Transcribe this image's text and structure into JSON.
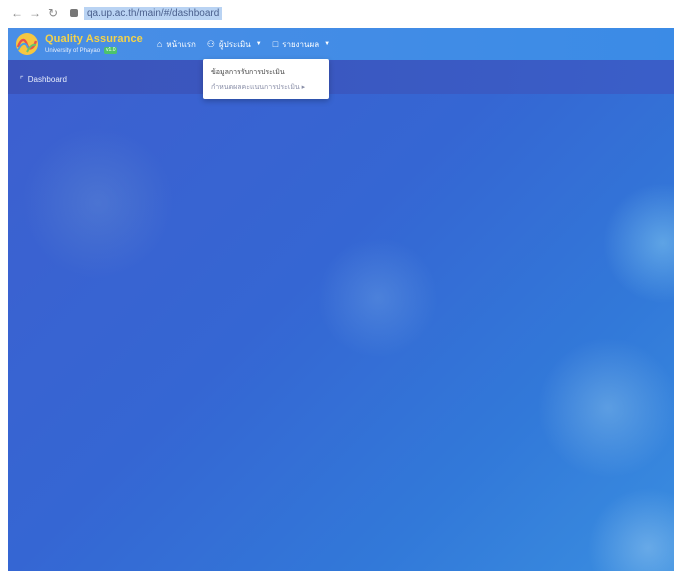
{
  "browser": {
    "back_icon": "arrow-left",
    "forward_icon": "arrow-right",
    "reload_icon": "reload",
    "url": "qa.up.ac.th/main/#/dashboard"
  },
  "navbar": {
    "brand_title": "Quality Assurance",
    "brand_subtitle": "University of Phayao",
    "brand_badge": "v1.0",
    "menu": [
      {
        "label": "หน้าแรก",
        "icon": "home-icon",
        "has_caret": false
      },
      {
        "label": "ผู้ประเมิน",
        "icon": "users-icon",
        "has_caret": true
      },
      {
        "label": "รายงานผล",
        "icon": "comment-icon",
        "has_caret": true
      }
    ]
  },
  "breadcrumb": {
    "label": "Dashboard",
    "icon": "chart-icon"
  },
  "dropdown": {
    "items": [
      {
        "label": "ข้อมูลการรับการประเมิน"
      },
      {
        "label": "กำหนดผลคะแนนการประเมิน ▸"
      }
    ]
  },
  "colors": {
    "navbar": "#3b8be6",
    "subbar": "#3a56c0",
    "brand_title": "#f3d24a",
    "background": "#3566d3"
  }
}
